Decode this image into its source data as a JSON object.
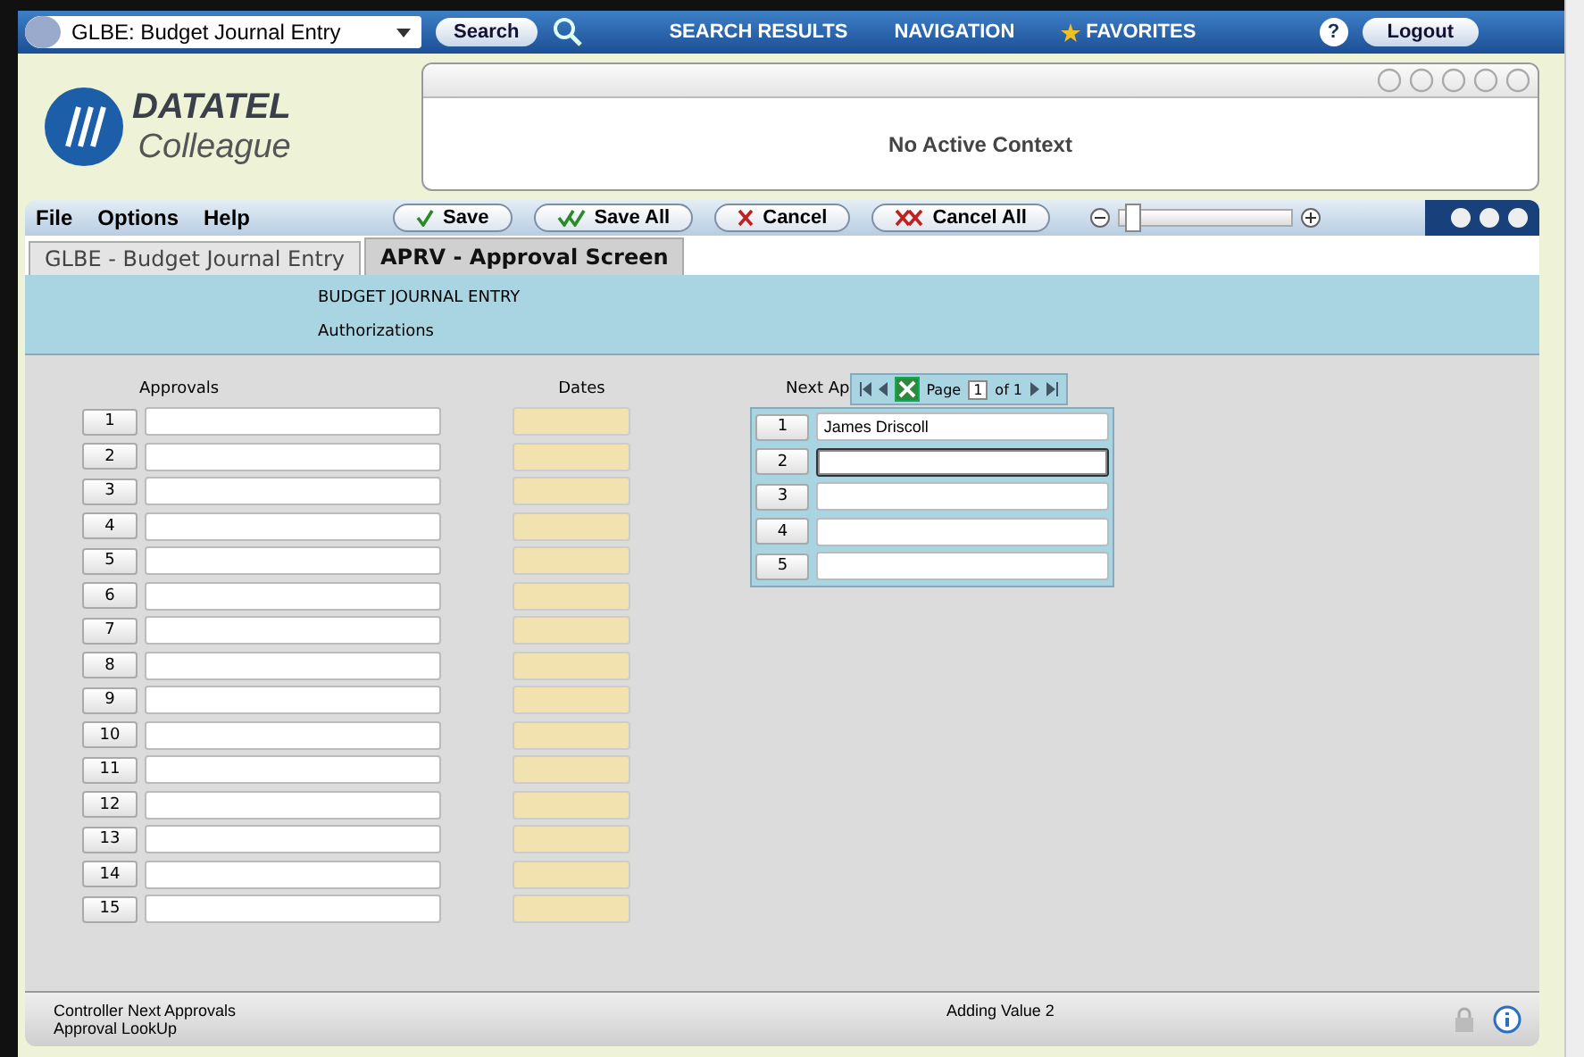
{
  "top_bar": {
    "module_select": "GLBE: Budget Journal Entry",
    "search_button": "Search",
    "nav_links": [
      {
        "label": "SEARCH RESULTS",
        "kind": "plain"
      },
      {
        "label": "NAVIGATION",
        "kind": "plain"
      },
      {
        "label": "FAVORITES",
        "kind": "star"
      }
    ],
    "help_button": "?",
    "logout_button": "Logout"
  },
  "logo": {
    "brand": "DATATEL",
    "product": "Colleague"
  },
  "context": {
    "message": "No Active Context"
  },
  "menu": [
    "File",
    "Options",
    "Help"
  ],
  "actions": [
    {
      "label": "Save",
      "kind": "check"
    },
    {
      "label": "Save All",
      "kind": "double-check"
    },
    {
      "label": "Cancel",
      "kind": "cross"
    },
    {
      "label": "Cancel All",
      "kind": "double-cross"
    }
  ],
  "zoom_slider": {
    "level": 0.03
  },
  "tabs": [
    {
      "label": "GLBE - Budget Journal Entry",
      "selected": false
    },
    {
      "label": "APRV - Approval Screen",
      "selected": true
    }
  ],
  "header": {
    "title": "BUDGET JOURNAL ENTRY",
    "subtitle": "Authorizations"
  },
  "approvals": {
    "heading": "Approvals",
    "dates_heading": "Dates",
    "rows": [
      "1",
      "2",
      "3",
      "4",
      "5",
      "6",
      "7",
      "8",
      "9",
      "10",
      "11",
      "12",
      "13",
      "14",
      "15"
    ]
  },
  "next_approvers": {
    "heading": "Next Ap",
    "pager": {
      "page_label": "Page",
      "page": "1",
      "of_label": "of 1"
    },
    "rows": [
      {
        "number": "1",
        "value": "James Driscoll",
        "focused": false
      },
      {
        "number": "2",
        "focused": true
      },
      {
        "number": "3",
        "focused": false
      },
      {
        "number": "4",
        "focused": false
      },
      {
        "number": "5",
        "focused": false
      }
    ]
  },
  "status_bar": {
    "left": [
      "Controller Next Approvals",
      "Approval LookUp"
    ],
    "center": "Adding Value 2"
  }
}
